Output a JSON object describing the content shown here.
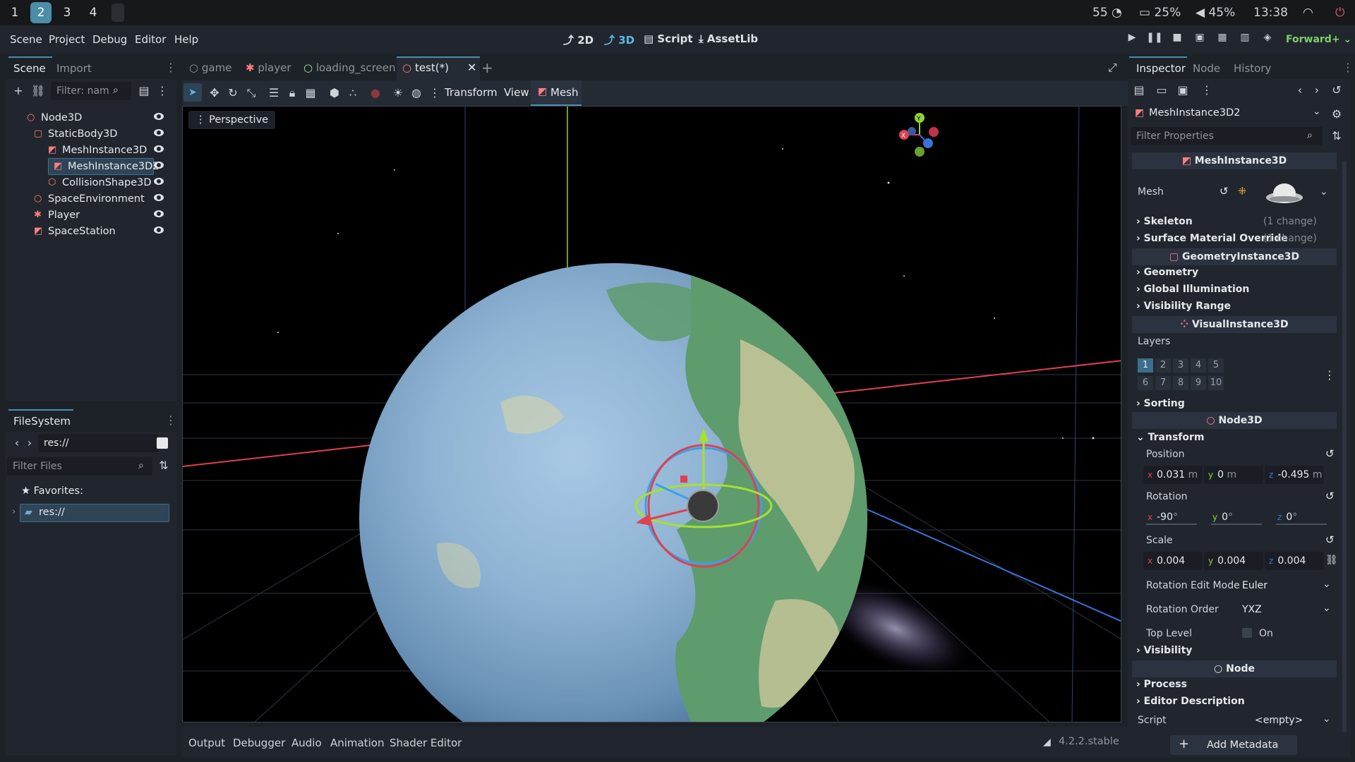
{
  "sysbar": {
    "workspaces": [
      "1",
      "2",
      "3",
      "4"
    ],
    "active_workspace": "2",
    "cpu": "55",
    "battery": "25%",
    "volume": "45%",
    "time": "13:38"
  },
  "menubar": {
    "menus": [
      "Scene",
      "Project",
      "Debug",
      "Editor",
      "Help"
    ],
    "workspaces": [
      "2D",
      "3D",
      "Script",
      "AssetLib"
    ],
    "active_workspace": "3D",
    "renderer": "Forward+"
  },
  "scene_dock": {
    "tabs": [
      "Scene",
      "Import"
    ],
    "filter_placeholder": "Filter: nam",
    "nodes": [
      {
        "label": "Node3D",
        "icon": "node3d-icon",
        "depth": 0,
        "selected": false
      },
      {
        "label": "StaticBody3D",
        "icon": "staticbody-icon",
        "depth": 1,
        "selected": false
      },
      {
        "label": "MeshInstance3D",
        "icon": "mesh-icon",
        "depth": 2,
        "selected": false
      },
      {
        "label": "MeshInstance3D2",
        "icon": "mesh-icon",
        "depth": 3,
        "selected": true
      },
      {
        "label": "CollisionShape3D",
        "icon": "collision-icon",
        "depth": 2,
        "selected": false
      },
      {
        "label": "SpaceEnvironment",
        "icon": "node3d-icon",
        "depth": 1,
        "selected": false
      },
      {
        "label": "Player",
        "icon": "player-icon",
        "depth": 1,
        "selected": false
      },
      {
        "label": "SpaceStation",
        "icon": "mesh-icon",
        "depth": 1,
        "selected": false
      }
    ]
  },
  "filesystem": {
    "title": "FileSystem",
    "path": "res://",
    "filter_placeholder": "Filter Files",
    "favorites_label": "Favorites:",
    "root_item": "res://"
  },
  "editor_tabs": [
    "game",
    "player",
    "loading_screen",
    "test(*)"
  ],
  "active_editor_tab": "test(*)",
  "viewport_toolbar": {
    "menus": [
      "Transform",
      "View",
      "Mesh"
    ],
    "perspective_label": "Perspective"
  },
  "bottom_panel": {
    "tabs": [
      "Output",
      "Debugger",
      "Audio",
      "Animation",
      "Shader Editor"
    ],
    "version": "4.2.2.stable"
  },
  "inspector": {
    "tabs": [
      "Inspector",
      "Node",
      "History"
    ],
    "object_name": "MeshInstance3D2",
    "filter_placeholder": "Filter Properties",
    "class_mesh": "MeshInstance3D",
    "mesh_label": "Mesh",
    "skeleton": "Skeleton",
    "skeleton_note": "(1 change)",
    "surface_override": "Surface Material Override",
    "surface_note": "(1 change)",
    "class_geometry": "GeometryInstance3D",
    "geometry": "Geometry",
    "global_illumination": "Global Illumination",
    "visibility_range": "Visibility Range",
    "class_visual": "VisualInstance3D",
    "layers_label": "Layers",
    "layers_row1": [
      "1",
      "2",
      "3",
      "4",
      "5"
    ],
    "layers_row2": [
      "6",
      "7",
      "8",
      "9",
      "10"
    ],
    "sorting": "Sorting",
    "class_node3d": "Node3D",
    "transform": "Transform",
    "position_label": "Position",
    "position": {
      "x": "0.031",
      "x_unit": "m",
      "y": "0",
      "y_unit": "m",
      "z": "-0.495",
      "z_unit": "m"
    },
    "rotation_label": "Rotation",
    "rotation": {
      "x": "-90",
      "y": "0",
      "z": "0",
      "unit": "°"
    },
    "scale_label": "Scale",
    "scale": {
      "x": "0.004",
      "y": "0.004",
      "z": "0.004"
    },
    "rotation_edit_mode_label": "Rotation Edit Mode",
    "rotation_edit_mode": "Euler",
    "rotation_order_label": "Rotation Order",
    "rotation_order": "YXZ",
    "top_level_label": "Top Level",
    "top_level_value": "On",
    "visibility": "Visibility",
    "class_node": "Node",
    "process": "Process",
    "editor_description": "Editor Description",
    "script_label": "Script",
    "script_value": "<empty>",
    "add_metadata": "Add Metadata"
  },
  "colors": {
    "accent": "#4c8ea8",
    "node_red": "#fc7f7f",
    "selected_bg": "#2f4456"
  }
}
